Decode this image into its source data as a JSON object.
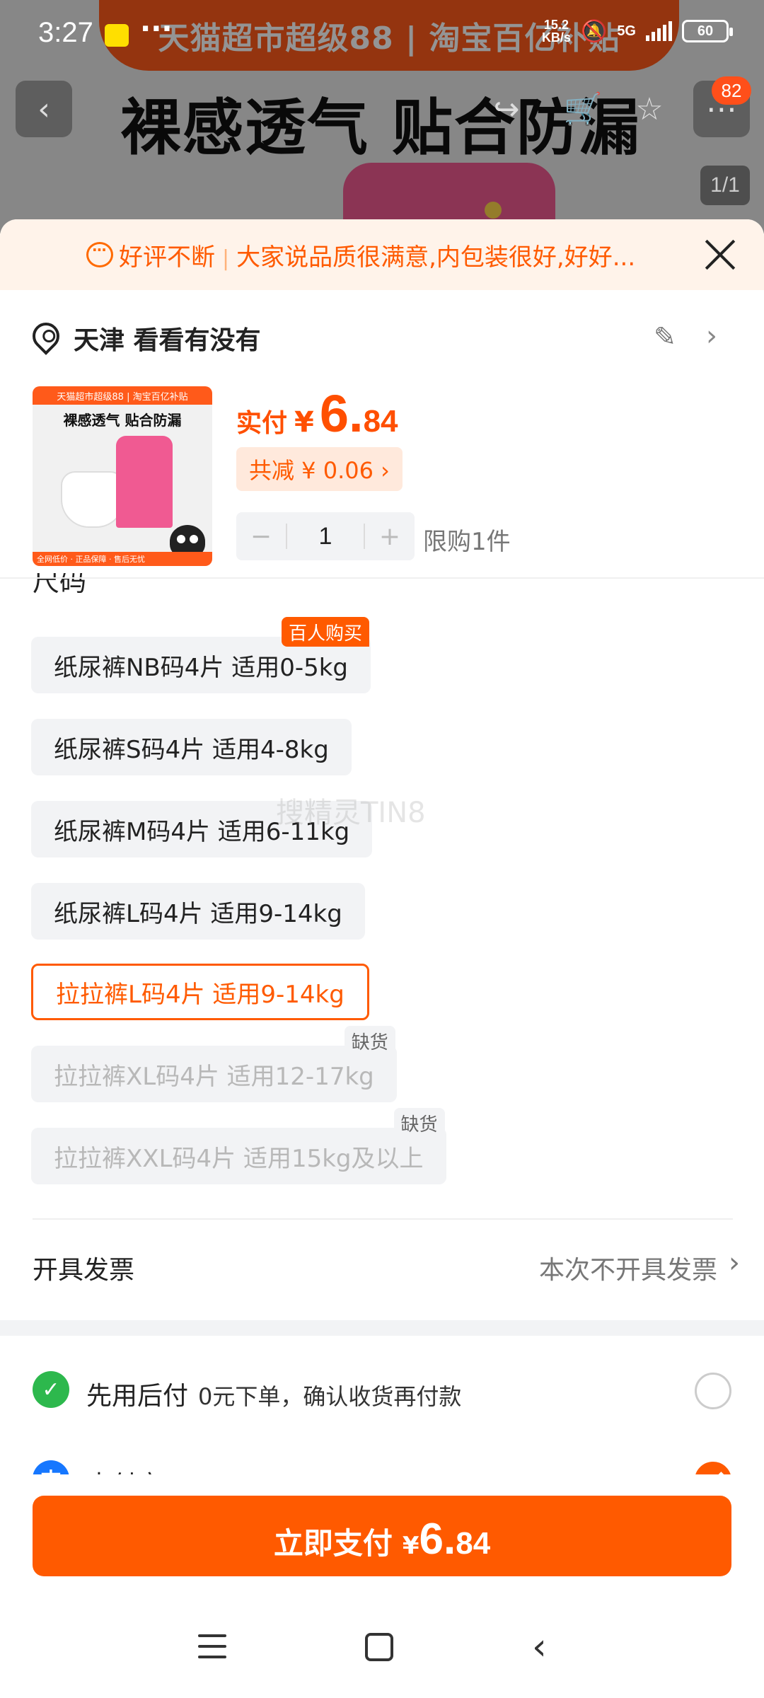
{
  "status_bar": {
    "time": "3:27",
    "net_speed_value": "15.2",
    "net_speed_unit": "KB/s",
    "network": "5G",
    "battery": "60",
    "dots": "···"
  },
  "background": {
    "banner_text": "天猫超市超级88 | 淘宝百亿补贴",
    "slogan": "裸感透气 贴合防漏",
    "cart_badge": "82",
    "image_counter": "1/1"
  },
  "review_bar": {
    "lead": "好评不断",
    "separator": "|",
    "text": "大家说品质很满意,内包装很好,好好..."
  },
  "address": {
    "text": "天津 看看有没有"
  },
  "product": {
    "thumb_banner": "天猫超市超级88 | 淘宝百亿补贴",
    "thumb_title": "裸感透气 贴合防漏",
    "thumb_footer": "全网低价 · 正品保障 · 售后无忧",
    "price_label": "实付",
    "currency": "¥",
    "price_int": "6.",
    "price_dec": "84",
    "discount": "共减 ¥ 0.06 ›"
  },
  "quantity": {
    "minus": "−",
    "value": "1",
    "plus": "+",
    "limit": "限购1件"
  },
  "size_section": {
    "title": "尺码",
    "options": [
      {
        "label": "纸尿裤NB码4片 适用0-5kg",
        "tag": "百人购买",
        "state": "normal"
      },
      {
        "label": "纸尿裤S码4片 适用4-8kg",
        "tag": "",
        "state": "normal"
      },
      {
        "label": "纸尿裤M码4片 适用6-11kg",
        "tag": "",
        "state": "normal"
      },
      {
        "label": "纸尿裤L码4片 适用9-14kg",
        "tag": "",
        "state": "normal"
      },
      {
        "label": "拉拉裤L码4片 适用9-14kg",
        "tag": "",
        "state": "selected"
      },
      {
        "label": "拉拉裤XL码4片 适用12-17kg",
        "tag": "缺货",
        "state": "disabled"
      },
      {
        "label": "拉拉裤XXL码4片 适用15kg及以上",
        "tag": "缺货",
        "state": "disabled"
      }
    ]
  },
  "watermark": "搜精灵TIN8",
  "invoice": {
    "label": "开具发票",
    "value": "本次不开具发票"
  },
  "payment": {
    "methods": [
      {
        "name": "先用后付",
        "sub": "0元下单，确认收货再付款",
        "selected": false,
        "icon": "pay-later-icon",
        "color": "#2db84d"
      },
      {
        "name": "支付宝",
        "sub": "",
        "selected": true,
        "icon": "alipay-icon",
        "color": "#1677ff"
      }
    ]
  },
  "pay_button": {
    "label": "立即支付",
    "currency": "¥",
    "amount_int": "6.",
    "amount_dec": "84"
  },
  "colors": {
    "accent": "#ff5a00",
    "review_bg": "#fff3ea",
    "chip_bg": "#f2f3f5"
  }
}
